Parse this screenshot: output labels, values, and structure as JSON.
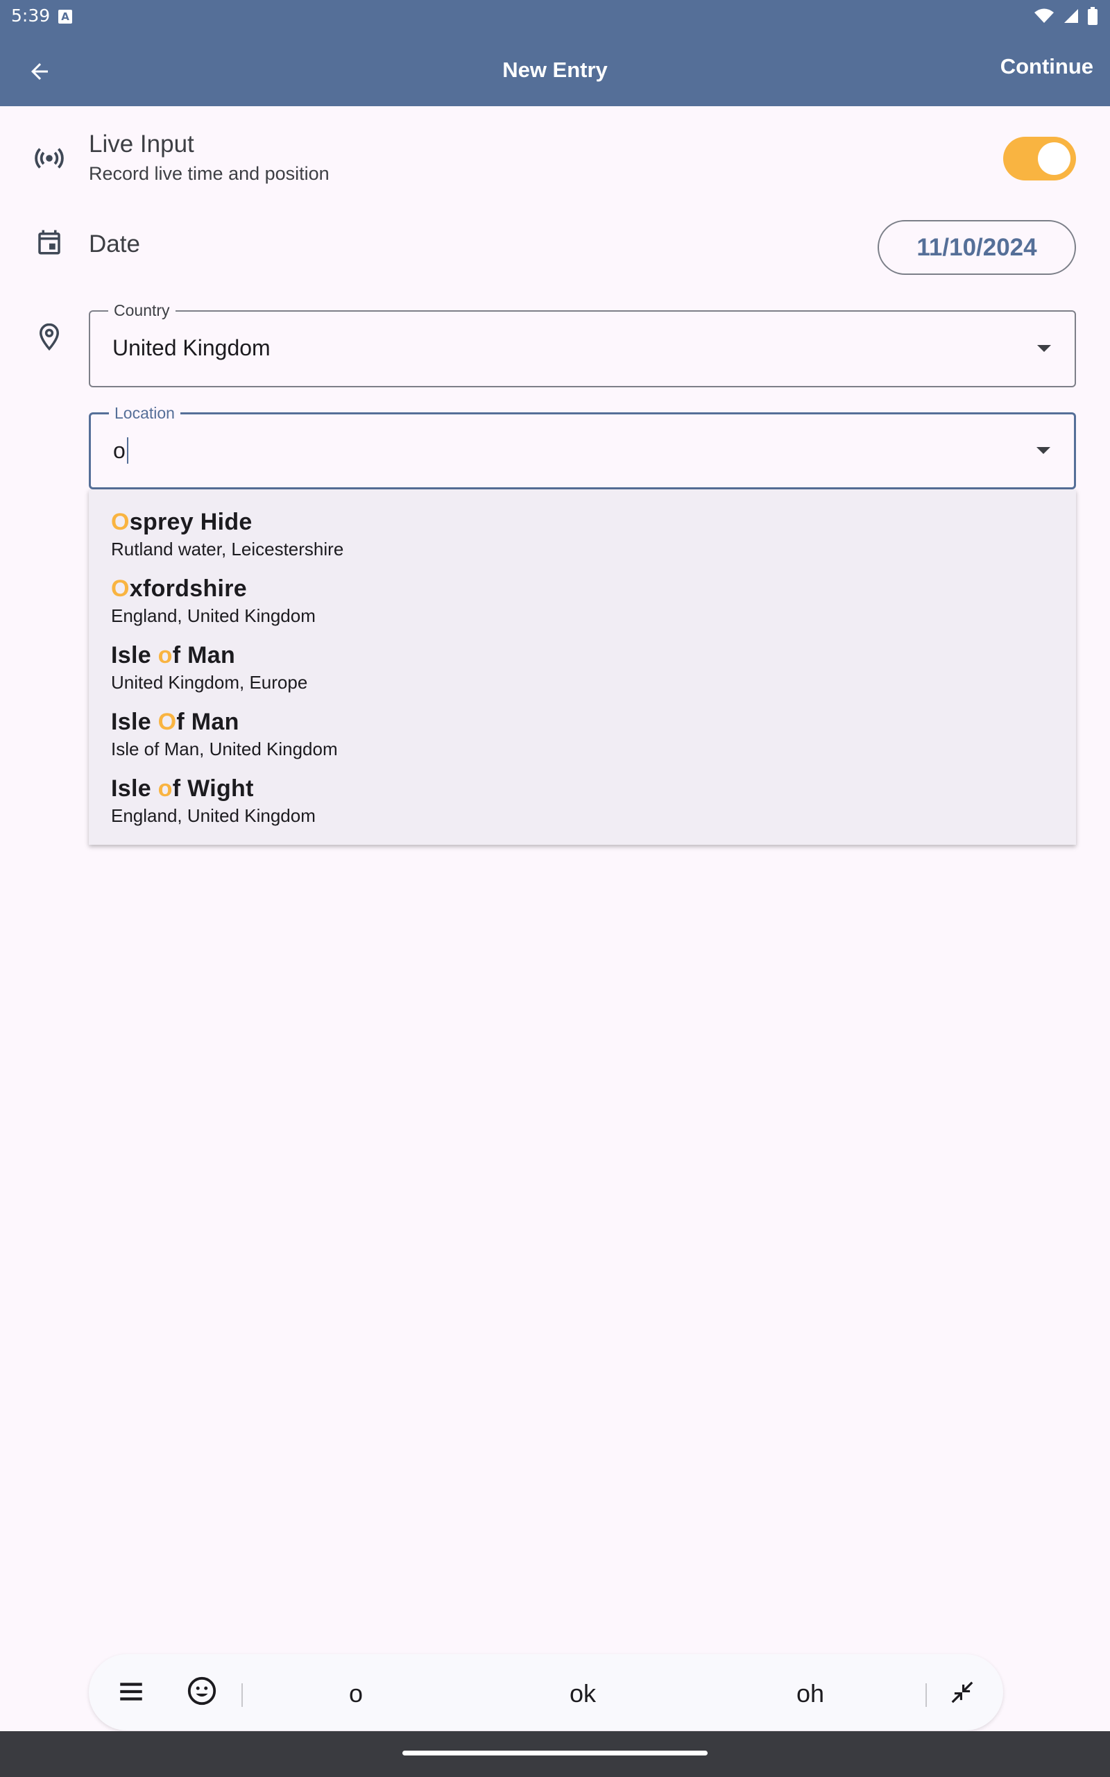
{
  "status_bar": {
    "time": "5:39",
    "notification_icon": "A"
  },
  "app_bar": {
    "title": "New Entry",
    "continue_label": "Continue",
    "back_icon": "arrow-back-icon"
  },
  "live_input": {
    "title": "Live Input",
    "subtitle": "Record live time and position",
    "enabled": true
  },
  "date": {
    "label": "Date",
    "value": "11/10/2024"
  },
  "country": {
    "label": "Country",
    "value": "United Kingdom"
  },
  "location": {
    "label": "Location",
    "value": "o"
  },
  "suggestions": [
    {
      "pre": "",
      "hl": "O",
      "post": "sprey Hide",
      "subtitle": "Rutland water, Leicestershire"
    },
    {
      "pre": "",
      "hl": "O",
      "post": "xfordshire",
      "subtitle": "England, United Kingdom"
    },
    {
      "pre": "Isle ",
      "hl": "o",
      "post": "f Man",
      "subtitle": "United Kingdom, Europe"
    },
    {
      "pre": "Isle ",
      "hl": "O",
      "post": "f Man",
      "subtitle": "Isle of Man, United Kingdom"
    },
    {
      "pre": "Isle ",
      "hl": "o",
      "post": "f Wight",
      "subtitle": "England, United Kingdom"
    }
  ],
  "keyboard": {
    "suggestions": [
      "o",
      "ok",
      "oh"
    ]
  },
  "colors": {
    "primary": "#556f98",
    "accent": "#f9b441",
    "background": "#fdf7fd"
  }
}
